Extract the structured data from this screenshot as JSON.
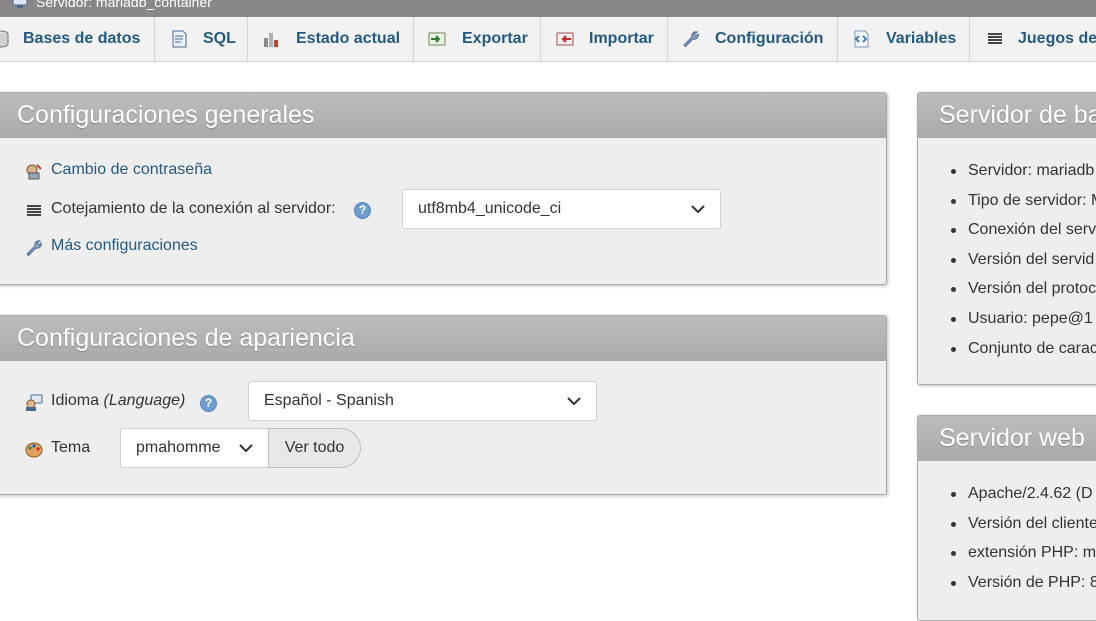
{
  "titlebar": {
    "text": "Servidor: mariadb_container"
  },
  "tabs": [
    {
      "label": "Bases de datos",
      "icon": "database-icon"
    },
    {
      "label": "SQL",
      "icon": "sql-icon"
    },
    {
      "label": "Estado actual",
      "icon": "status-chart-icon"
    },
    {
      "label": "Exportar",
      "icon": "export-icon"
    },
    {
      "label": "Importar",
      "icon": "import-icon"
    },
    {
      "label": "Configuración",
      "icon": "wrench-icon"
    },
    {
      "label": "Variables",
      "icon": "variables-icon"
    },
    {
      "label": "Juegos de",
      "icon": "charset-icon"
    }
  ],
  "general": {
    "title": "Configuraciones generales",
    "change_password": "Cambio de contraseña",
    "collation_label": "Cotejamiento de la conexión al servidor:",
    "collation_value": "utf8mb4_unicode_ci",
    "more_settings": "Más configuraciones"
  },
  "appearance": {
    "title": "Configuraciones de apariencia",
    "language_label": "Idioma",
    "language_label_en": "(Language)",
    "language_value": "Español - Spanish",
    "theme_label": "Tema",
    "theme_value": "pmahomme",
    "view_all": "Ver todo"
  },
  "db_server": {
    "title": "Servidor de ba",
    "items": [
      "Servidor: mariadb",
      "Tipo de servidor: M",
      "Conexión del serv",
      "Versión del servid",
      "Versión del protoc",
      "Usuario: pepe@1",
      "Conjunto de carac"
    ]
  },
  "web_server": {
    "title": "Servidor web",
    "items": [
      "Apache/2.4.62 (D",
      "Versión del cliente",
      "extensión PHP: m",
      "Versión de PHP: 8"
    ]
  },
  "colors": {
    "link": "#235a81",
    "panel_header": "#afafaf",
    "help": "#6d9ed2"
  }
}
